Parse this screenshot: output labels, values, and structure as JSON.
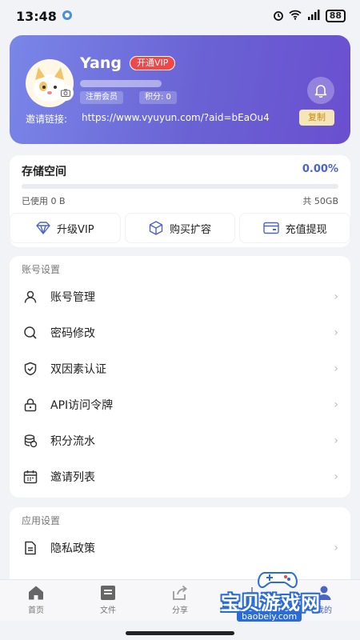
{
  "status_bar": {
    "time": "13:48",
    "battery": "88"
  },
  "profile": {
    "username": "Yang",
    "vip_button": "开通VIP",
    "tags": [
      "注册会员",
      "积分: 0"
    ],
    "invite_label": "邀请链接:",
    "invite_url": "https://www.vyuyun.com/?aid=bEaOu4",
    "copy_label": "复制"
  },
  "storage": {
    "title": "存储空间",
    "percent": "0.00%",
    "progress": 0.0,
    "used": "已使用 0 B",
    "total": "共 50GB",
    "actions": [
      {
        "label": "升级VIP",
        "icon": "diamond-icon"
      },
      {
        "label": "购买扩容",
        "icon": "box-icon"
      },
      {
        "label": "充值提现",
        "icon": "card-icon"
      }
    ]
  },
  "account_settings": {
    "title": "账号设置",
    "items": [
      {
        "label": "账号管理",
        "icon": "user-icon"
      },
      {
        "label": "密码修改",
        "icon": "search-icon"
      },
      {
        "label": "双因素认证",
        "icon": "shield-icon"
      },
      {
        "label": "API访问令牌",
        "icon": "lock-icon"
      },
      {
        "label": "积分流水",
        "icon": "coins-icon"
      },
      {
        "label": "邀请列表",
        "icon": "calendar-icon"
      }
    ]
  },
  "app_settings": {
    "title": "应用设置",
    "items": [
      {
        "label": "隐私政策",
        "icon": "document-icon"
      }
    ]
  },
  "bottom_nav": [
    {
      "label": "首页",
      "icon": "home-icon"
    },
    {
      "label": "文件",
      "icon": "file-icon"
    },
    {
      "label": "分享",
      "icon": "share-icon"
    },
    {
      "label": "",
      "icon": "plus-icon"
    },
    {
      "label": "我的",
      "icon": "profile-icon"
    }
  ],
  "watermark": {
    "text": "宝贝游戏网",
    "url": "baobeiy.com"
  },
  "colors": {
    "accent": "#4a64c8",
    "card_gradient_start": "#7a86e8",
    "card_gradient_end": "#6a4fcf",
    "vip_red": "#f04848"
  }
}
